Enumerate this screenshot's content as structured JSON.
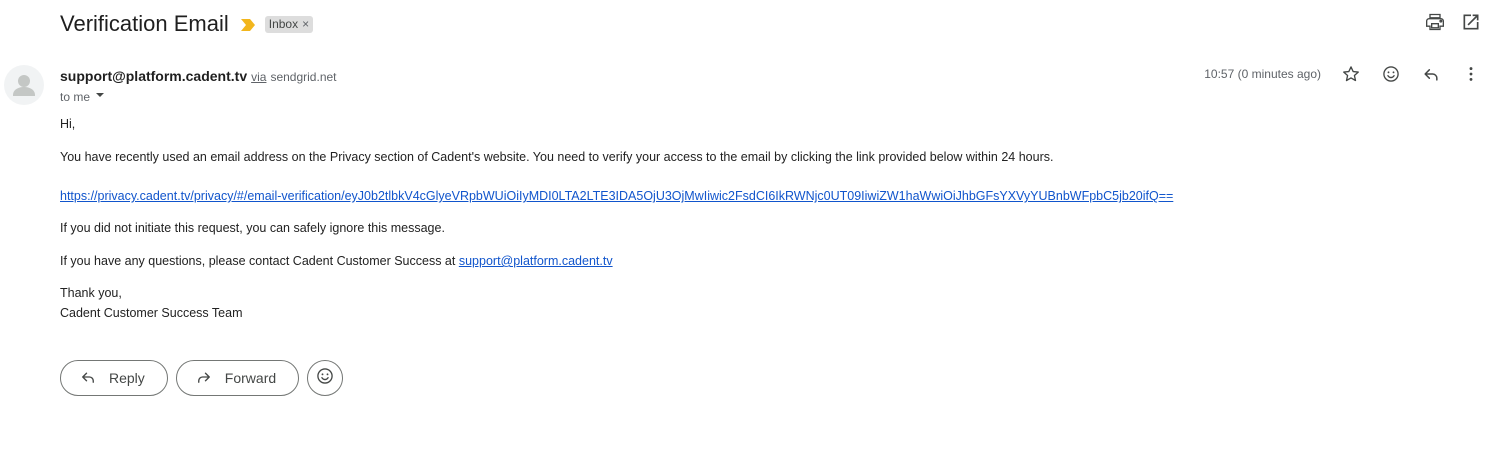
{
  "email": {
    "subject": "Verification Email",
    "label": "Inbox",
    "label_remove": "×",
    "sender": "support@platform.cadent.tv",
    "via_text": "via",
    "via_domain": "sendgrid.net",
    "to_text": "to me",
    "timestamp": "10:57 (0 minutes ago)"
  },
  "body": {
    "greeting": "Hi,",
    "paragraph1": "You have recently used an email address on the Privacy section of Cadent's website. You need to verify your access to the email by clicking the link provided below within 24 hours.",
    "verification_link": "https://privacy.cadent.tv/privacy/#/email-verification/eyJ0b2tlbkV4cGlyeVRpbWUiOiIyMDI0LTA2LTE3IDA5OjU3OjMwIiwic2FsdCI6IkRWNjc0UT09IiwiZW1haWwiOiJhbGFsYXVyYUBnbWFpbC5jb20ifQ==",
    "paragraph2": "If you did not initiate this request, you can safely ignore this message.",
    "paragraph3_prefix": "If you have any questions, please contact Cadent Customer Success at ",
    "contact_link": "support@platform.cadent.tv",
    "signoff": "Thank you,",
    "signature": "Cadent Customer Success Team"
  },
  "actions": {
    "reply": "Reply",
    "forward": "Forward"
  },
  "icons": {
    "importance": "importance-marker-icon",
    "print": "print-icon",
    "new_window": "open-in-new-window-icon",
    "star": "star-icon",
    "emoji": "emoji-icon",
    "reply": "reply-icon",
    "more": "more-vert-icon",
    "forward": "forward-icon"
  },
  "colors": {
    "importance": "#f2b61d",
    "link": "#1155cc",
    "chip": "#dddddd"
  }
}
